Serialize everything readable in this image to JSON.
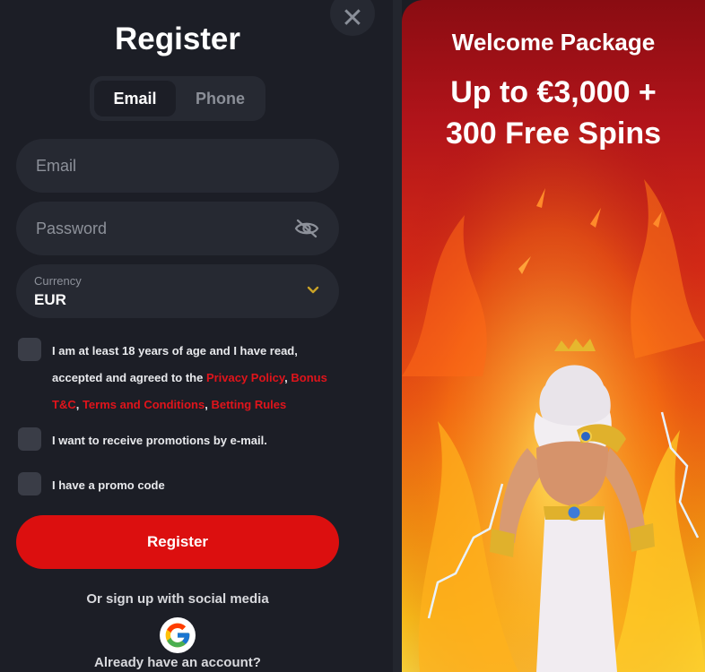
{
  "register_form": {
    "title": "Register",
    "tabs": [
      {
        "label": "Email",
        "active": true
      },
      {
        "label": "Phone",
        "active": false
      }
    ],
    "email_placeholder": "Email",
    "password_placeholder": "Password",
    "currency": {
      "label": "Currency",
      "value": "EUR"
    },
    "terms": {
      "text_1": "I am at least 18 years of age and I have read, accepted and agreed to the ",
      "link_privacy": "Privacy Policy",
      "sep_1": ", ",
      "link_bonus": "Bonus T&C",
      "sep_2": ", ",
      "link_terms": "Terms and Conditions",
      "sep_3": ", ",
      "link_betting": "Betting Rules"
    },
    "promo_email_label": "I want to receive promotions by e-mail.",
    "promo_code_label": "I have a promo code",
    "register_button": "Register",
    "social_text": "Or sign up with social media",
    "login_text": "Already have an account?",
    "close_symbol": "✕"
  },
  "promo": {
    "subtitle": "Welcome Package",
    "headline_line1": "Up to €3,000 +",
    "headline_line2": "300 Free Spins"
  },
  "colors": {
    "accent_red": "#dc0f0f",
    "link_red": "#e0141b",
    "panel_bg": "#1c1e26",
    "field_bg": "#262932"
  },
  "icons": [
    "close-icon",
    "eye-off-icon",
    "chevron-down-icon",
    "google-icon"
  ]
}
